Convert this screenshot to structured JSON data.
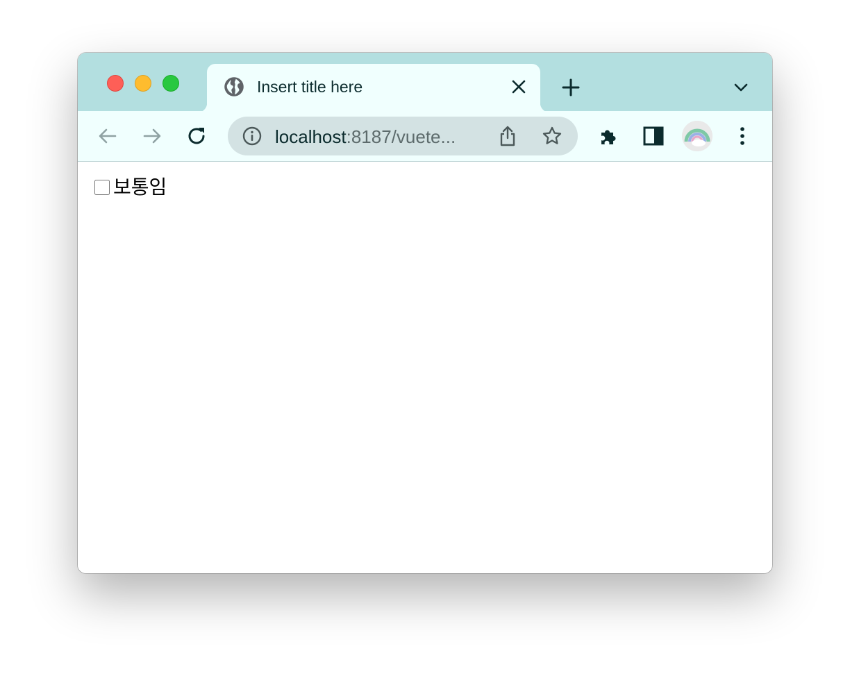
{
  "tab": {
    "title": "Insert title here"
  },
  "omnibox": {
    "host": "localhost",
    "path": ":8187/vuete..."
  },
  "page": {
    "checkbox_label": "보통임",
    "checkbox_checked": false
  }
}
